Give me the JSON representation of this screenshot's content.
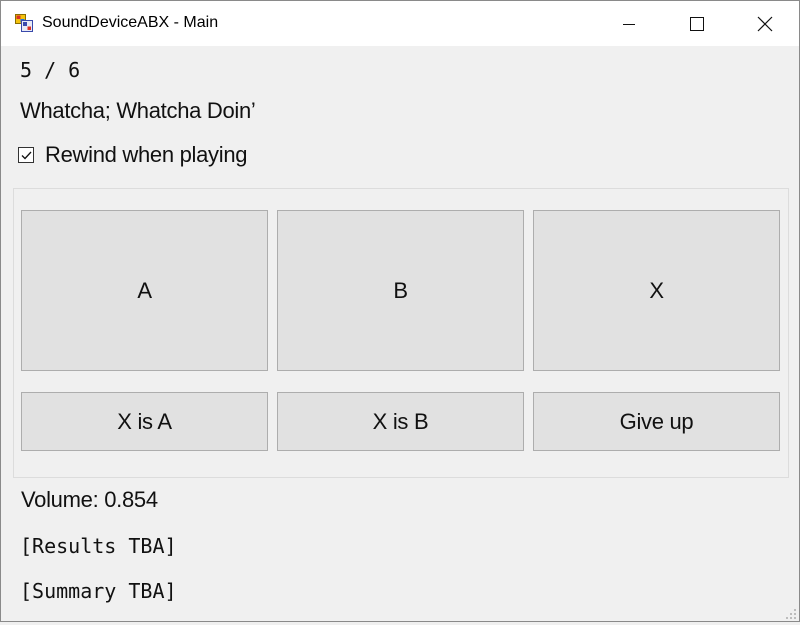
{
  "window": {
    "title": "SoundDeviceABX - Main",
    "controls": [
      "minimize-icon",
      "maximize-icon",
      "close-icon"
    ]
  },
  "counter": "5 / 6",
  "track_title": "Whatcha; Whatcha Doin’",
  "rewind": {
    "label": "Rewind when playing",
    "checked": true
  },
  "playback_buttons": {
    "a": "A",
    "b": "B",
    "x": "X"
  },
  "answer_buttons": {
    "x_is_a": "X is A",
    "x_is_b": "X is B",
    "give_up": "Give up"
  },
  "volume": "Volume: 0.854",
  "results": "[Results TBA]",
  "summary": "[Summary TBA]"
}
